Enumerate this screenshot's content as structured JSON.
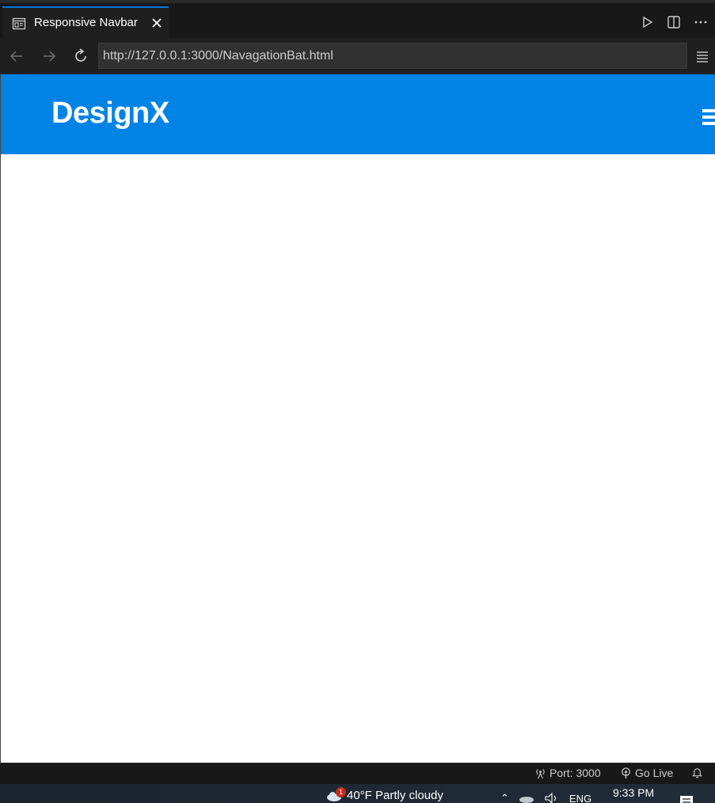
{
  "tab": {
    "title": "Responsive Navbar",
    "icon": "browser-preview-icon"
  },
  "address_bar": {
    "url": "http://127.0.0.1:3000/NavagationBat.html"
  },
  "page": {
    "logo": "DesignX",
    "header_color": "#0183e6"
  },
  "status_bar": {
    "port": "Port: 3000",
    "go_live": "Go Live"
  },
  "taskbar": {
    "weather": "40°F  Partly cloudy",
    "weather_badge": "1",
    "language": "ENG",
    "time": "9:33 PM"
  }
}
